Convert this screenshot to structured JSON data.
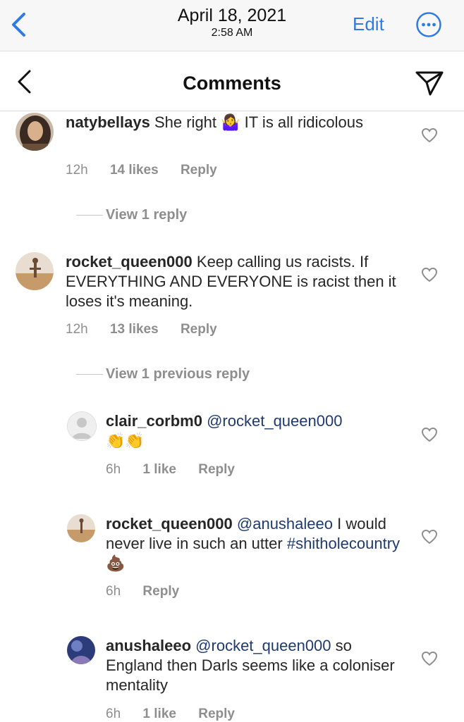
{
  "photos_bar": {
    "date": "April 18, 2021",
    "time": "2:58 AM",
    "edit_label": "Edit"
  },
  "header": {
    "title": "Comments"
  },
  "comments": [
    {
      "username": "natybellays",
      "text_before_emoji": "She right ",
      "emoji": "🤷‍♀️",
      "text_after_emoji": " IT is all ridicolous",
      "time": "12h",
      "likes": "14 likes",
      "reply": "Reply",
      "view_replies": "View 1 reply"
    },
    {
      "username": "rocket_queen000",
      "text": "Keep calling us racists. If EVERYTHING AND EVERYONE is racist then it loses it's meaning.",
      "time": "12h",
      "likes": "13 likes",
      "reply": "Reply",
      "view_replies": "View 1 previous reply"
    }
  ],
  "replies": [
    {
      "username": "clair_corbm0",
      "mention": "@rocket_queen000",
      "emoji": "👏👏",
      "time": "6h",
      "likes": "1 like",
      "reply": "Reply"
    },
    {
      "username": "rocket_queen000",
      "mention": "@anushaleeo",
      "text": "I would never live in such an utter",
      "hashtag": "#shitholecountry",
      "emoji": "💩",
      "time": "6h",
      "reply": "Reply"
    },
    {
      "username": "anushaleeo",
      "mention": "@rocket_queen000",
      "text": "so England then Darls seems like a coloniser mentality",
      "time": "6h",
      "likes": "1 like",
      "reply": "Reply"
    }
  ],
  "colors": {
    "ios_blue": "#2f7ae5",
    "mention": "#1f3a6e",
    "meta_gray": "#8e8e8e"
  }
}
